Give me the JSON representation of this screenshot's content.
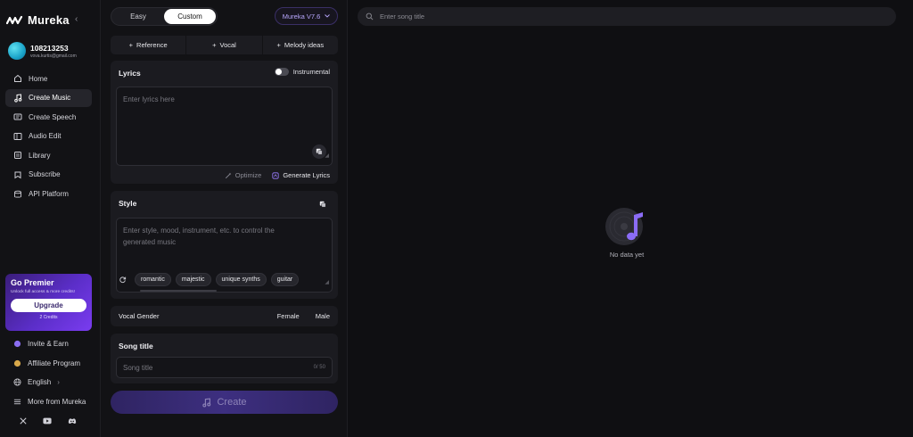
{
  "app": {
    "name": "Mureka"
  },
  "user": {
    "name": "108213253",
    "email": "vova.kurtis@gmail.com"
  },
  "sidebar": {
    "items": [
      {
        "label": "Home",
        "icon": "home-icon"
      },
      {
        "label": "Create Music",
        "icon": "music-note-icon",
        "active": true
      },
      {
        "label": "Create Speech",
        "icon": "speech-icon"
      },
      {
        "label": "Audio Edit",
        "icon": "audio-edit-icon"
      },
      {
        "label": "Library",
        "icon": "library-icon"
      },
      {
        "label": "Subscribe",
        "icon": "subscribe-icon"
      },
      {
        "label": "API Platform",
        "icon": "api-icon"
      }
    ],
    "promo": {
      "title": "Go Premier",
      "subtitle": "Unlock full access & more credits!",
      "button": "Upgrade",
      "credits": "2 Credits"
    },
    "bottom": [
      {
        "label": "Invite & Earn",
        "icon": "gift-icon"
      },
      {
        "label": "Affiliate Program",
        "icon": "affiliate-icon"
      },
      {
        "label": "English",
        "icon": "globe-icon",
        "chevron": "›"
      },
      {
        "label": "More from Mureka",
        "icon": "menu-icon"
      }
    ],
    "socials": [
      "x-icon",
      "youtube-icon",
      "discord-icon"
    ]
  },
  "composer": {
    "modes": {
      "easy": "Easy",
      "custom": "Custom",
      "active": "Custom"
    },
    "model": "Mureka V7.6",
    "add_buttons": [
      "Reference",
      "Vocal",
      "Melody ideas"
    ],
    "lyrics": {
      "title": "Lyrics",
      "instrumental_label": "Instrumental",
      "instrumental_on": false,
      "placeholder": "Enter lyrics here",
      "optimize": "Optimize",
      "generate": "Generate Lyrics"
    },
    "style": {
      "title": "Style",
      "placeholder": "Enter style, mood, instrument, etc. to control the generated music",
      "tags": [
        "romantic",
        "majestic",
        "unique synths",
        "guitar"
      ]
    },
    "vocal_gender": {
      "label": "Vocal Gender",
      "options": [
        "Female",
        "Male"
      ]
    },
    "song_title": {
      "title": "Song title",
      "placeholder": "Song title",
      "count": "0/ 50"
    },
    "create": "Create"
  },
  "library": {
    "search_placeholder": "Enter song title",
    "empty_text": "No data yet"
  },
  "colors": {
    "accent": "#7a5cf5",
    "background": "#0f0f12",
    "panel": "#1b1b20"
  }
}
